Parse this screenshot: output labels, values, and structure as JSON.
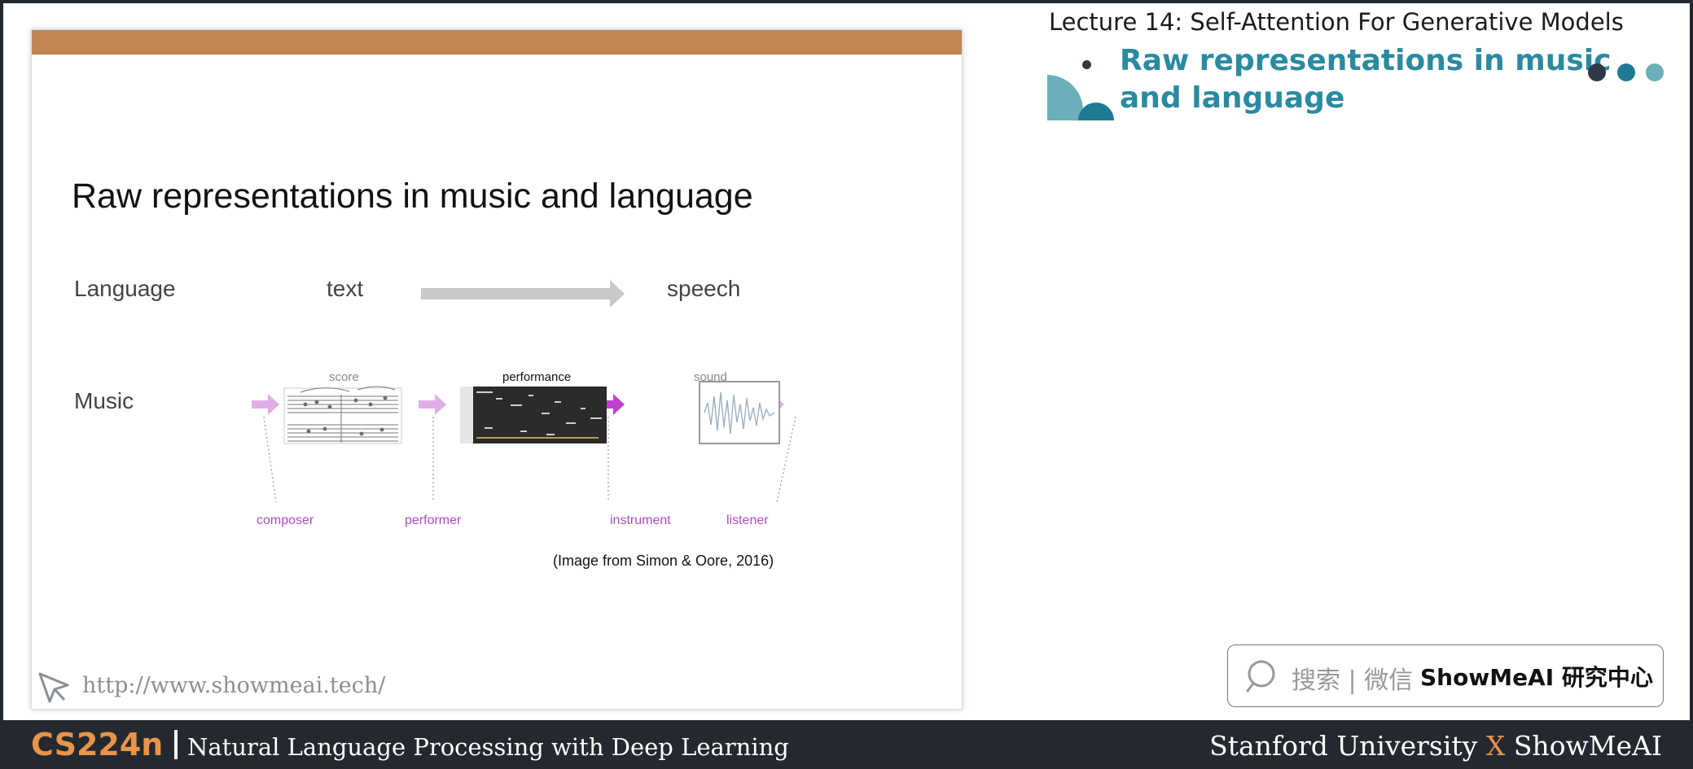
{
  "header": {
    "lecture_title": "Lecture 14:  Self-Attention For Generative Models",
    "section_title": "Raw representations in music and language"
  },
  "slide": {
    "title": "Raw representations in music and language",
    "language_label": "Language",
    "text_label": "text",
    "speech_label": "speech",
    "music_label": "Music",
    "figure": {
      "score_label": "score",
      "performance_label": "performance",
      "sound_label": "sound",
      "composer_label": "composer",
      "performer_label": "performer",
      "instrument_label": "instrument",
      "listener_label": "listener"
    },
    "caption": "(Image from Simon & Oore, 2016)",
    "url": "http://www.showmeai.tech/"
  },
  "search": {
    "label": "搜索 | 微信",
    "brand": "ShowMeAI 研究中心"
  },
  "footer": {
    "course": "CS224n",
    "subtitle": "Natural Language Processing with Deep Learning",
    "right_a": "Stanford University",
    "right_x": "X",
    "right_b": "ShowMeAI"
  },
  "colors": {
    "slide_bar": "#bf8651",
    "accent_teal": "#2a8aa0",
    "accent_orange": "#e8944a",
    "footer_bg": "#24292f",
    "music_pink": "#b04ac2"
  }
}
